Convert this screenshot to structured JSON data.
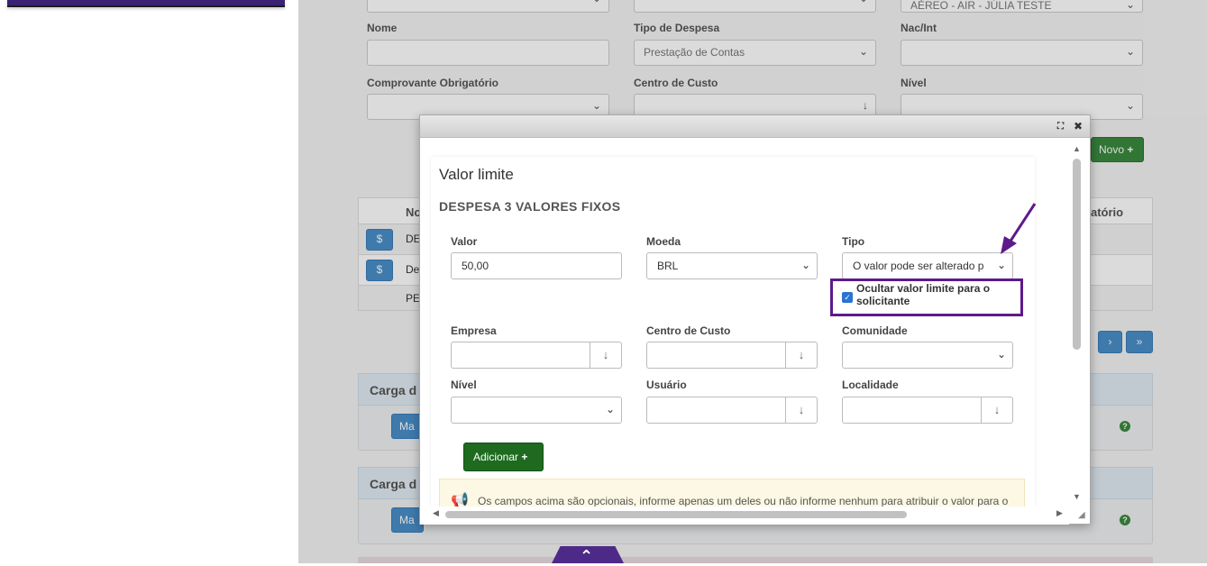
{
  "background": {
    "labels": {
      "nome": "Nome",
      "tipo_despesa": "Tipo de Despesa",
      "nac_int": "Nac/Int",
      "comprovante": "Comprovante Obrigatório",
      "centro_custo": "Centro de Custo",
      "nivel": "Nível"
    },
    "top_right_value": "AÉREO - AIR - JÚLIA TESTE",
    "tipo_despesa_value": "Prestação de Contas",
    "novo_label": "Novo",
    "table": {
      "col_no": "No",
      "col_obrigatorio": "atório",
      "rows": [
        {
          "badge": "$",
          "text": "DE"
        },
        {
          "badge": "$",
          "text": "De"
        },
        {
          "badge": "",
          "text": "PE"
        }
      ]
    },
    "pager": {
      "next": "›",
      "last": "»"
    },
    "panels": [
      {
        "title": "Carga d",
        "button": "Ma"
      },
      {
        "title": "Carga d",
        "button": "Ma"
      }
    ],
    "help": "?"
  },
  "modal": {
    "title": "Valor limite",
    "subtitle": "DESPESA 3 VALORES FIXOS",
    "fields": {
      "valor": {
        "label": "Valor",
        "value": "50,00"
      },
      "moeda": {
        "label": "Moeda",
        "value": "BRL"
      },
      "tipo": {
        "label": "Tipo",
        "value": "O valor pode ser alterado p"
      },
      "empresa": {
        "label": "Empresa"
      },
      "centro_custo": {
        "label": "Centro de Custo"
      },
      "comunidade": {
        "label": "Comunidade"
      },
      "nivel": {
        "label": "Nível"
      },
      "usuario": {
        "label": "Usuário"
      },
      "localidade": {
        "label": "Localidade"
      }
    },
    "checkbox": {
      "label": "Ocultar valor limite para o solicitante",
      "checked": true
    },
    "add_button": "Adicionar",
    "info_text": "Os campos acima são opcionais, informe apenas um deles ou não informe nenhum para atribuir o valor para o"
  },
  "colors": {
    "highlight": "#5d1a8a",
    "add_button": "#1e6b1f",
    "accent_purple": "#4d2a88"
  }
}
